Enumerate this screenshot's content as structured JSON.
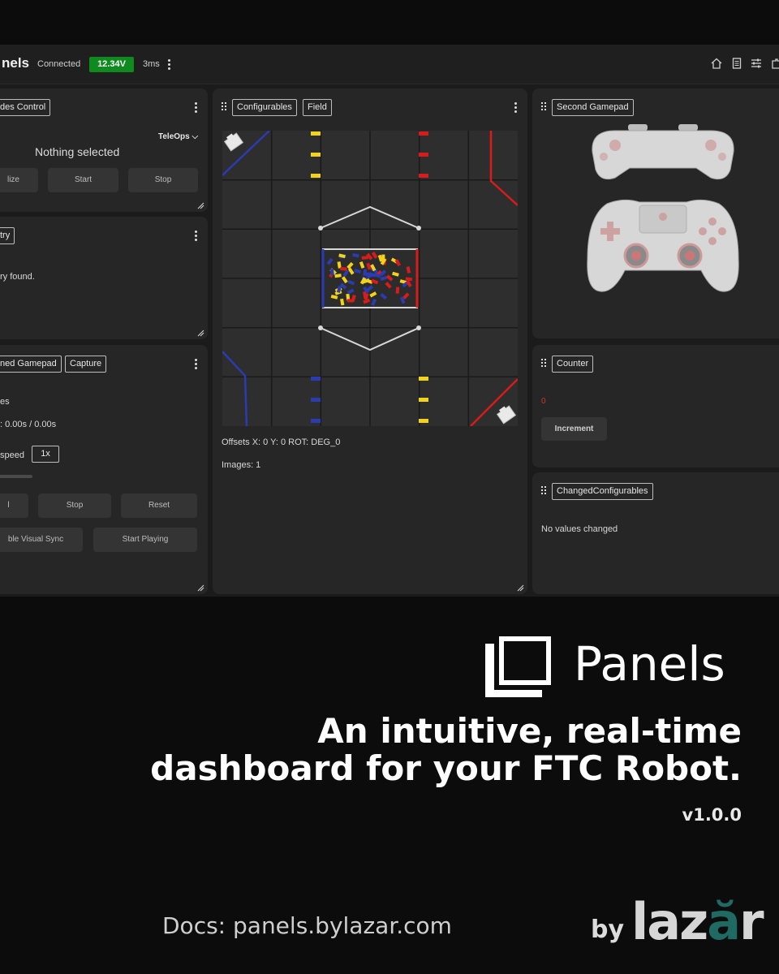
{
  "app": {
    "brand": "nels",
    "status": "Connected",
    "voltage": "12.34V",
    "latency": "3ms"
  },
  "opmodes_panel": {
    "tab": "des Control",
    "mode_select": "TeleOps",
    "selection": "Nothing selected",
    "buttons": [
      "lize",
      "Start",
      "Stop"
    ]
  },
  "telemetry_panel": {
    "tab": "try",
    "message": "ry found."
  },
  "gamepad_panel": {
    "tabs": [
      "ned Gamepad",
      "Capture"
    ],
    "line1": "es",
    "time": ": 0.00s / 0.00s",
    "speed_label": "speed",
    "speed_value": "1x",
    "buttons_row1": [
      "l",
      "Stop",
      "Reset"
    ],
    "buttons_row2": [
      "ble Visual Sync",
      "Start Playing"
    ]
  },
  "field_panel": {
    "tabs": [
      "Configurables",
      "Field"
    ],
    "offsets": "Offsets X: 0 Y: 0 ROT: DEG_0",
    "images": "Images: 1"
  },
  "second_gamepad_panel": {
    "tab": "Second Gamepad"
  },
  "counter_panel": {
    "tab": "Counter",
    "value": "0",
    "button": "Increment"
  },
  "changed_panel": {
    "tab": "ChangedConfigurables",
    "message": "No values changed"
  },
  "promo": {
    "title": "Panels",
    "headline_line1": "An intuitive, real-time",
    "headline_line2": "dashboard for your FTC Robot.",
    "version": "v1.0.0",
    "docs": "Docs: panels.bylazar.com",
    "by": "by",
    "logo_part1": "laz",
    "logo_part2": "ă",
    "logo_part3": "r"
  },
  "colors": {
    "voltage_ok": "#0e8a1f",
    "alliance_red": "#d81b1b",
    "alliance_blue": "#2b3bb0",
    "sample_yellow": "#f2d21b",
    "counter_value": "#d13333",
    "logo_teal": "#1f6b63"
  },
  "icons": [
    "home-icon",
    "document-icon",
    "sliders-icon",
    "puzzle-icon"
  ]
}
